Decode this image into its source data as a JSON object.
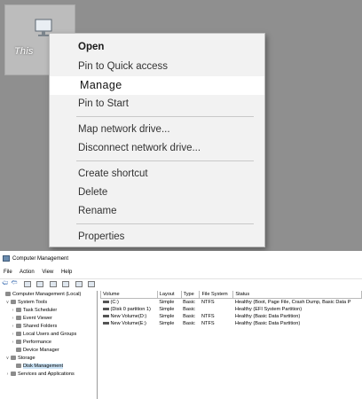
{
  "desktop": {
    "icon_label": "This"
  },
  "context_menu": {
    "items": [
      "Open",
      "Pin to Quick access",
      "Manage",
      "Pin to Start",
      "Map network drive...",
      "Disconnect network drive...",
      "Create shortcut",
      "Delete",
      "Rename",
      "Properties"
    ],
    "bold_item": "Open",
    "highlighted_item": "Manage"
  },
  "computer_management": {
    "title": "Computer Management",
    "menu": [
      "File",
      "Action",
      "View",
      "Help"
    ],
    "tree": [
      "Computer Management (Local)",
      "System Tools",
      "Task Scheduler",
      "Event Viewer",
      "Shared Folders",
      "Local Users and Groups",
      "Performance",
      "Device Manager",
      "Storage",
      "Disk Management",
      "Services and Applications"
    ],
    "selected_tree_item": "Disk Management",
    "table": {
      "columns": [
        "Volume",
        "Layout",
        "Type",
        "File System",
        "Status"
      ],
      "rows": [
        [
          "(C:)",
          "Simple",
          "Basic",
          "NTFS",
          "Healthy (Boot, Page File, Crash Dump, Basic Data P"
        ],
        [
          "(Disk 0 partition 1)",
          "Simple",
          "Basic",
          "",
          "Healthy (EFI System Partition)"
        ],
        [
          "New Volume(D:)",
          "Simple",
          "Basic",
          "NTFS",
          "Healthy (Basic Data Partition)"
        ],
        [
          "New Volume(E:)",
          "Simple",
          "Basic",
          "NTFS",
          "Healthy (Basic Data Partition)"
        ]
      ]
    }
  }
}
